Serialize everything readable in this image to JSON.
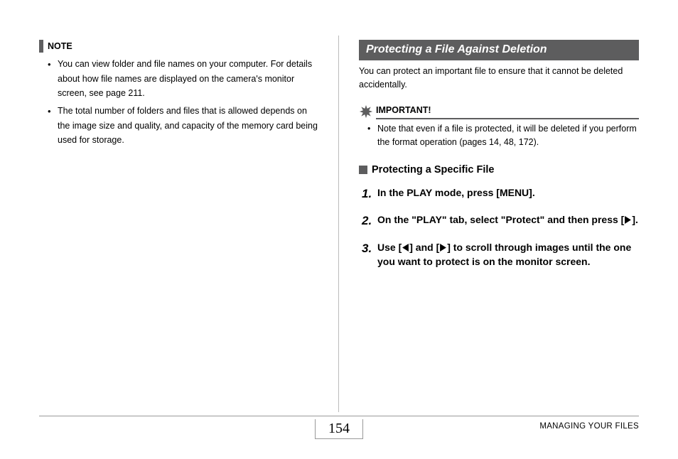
{
  "left": {
    "note_label": "NOTE",
    "bullets": [
      "You can view folder and file names on your computer. For details about how file names are displayed on the camera's monitor screen, see page 211.",
      "The total number of folders and files that is allowed depends on the image size and quality, and capacity of the memory card being used for storage."
    ]
  },
  "right": {
    "section_title": "Protecting a File Against Deletion",
    "intro": "You can protect an important file to ensure that it cannot be deleted accidentally.",
    "important_label": "IMPORTANT!",
    "important_bullets": [
      "Note that even if a file is protected, it will be deleted if you perform the format operation (pages 14, 48, 172)."
    ],
    "subheading": "Protecting a Specific File",
    "steps": {
      "s1": {
        "num": "1.",
        "text": "In the PLAY mode, press [MENU]."
      },
      "s2": {
        "num": "2.",
        "pre": "On the \"PLAY\" tab, select \"Protect\" and then press [",
        "post": "]."
      },
      "s3": {
        "num": "3.",
        "pre": "Use [",
        "mid": "] and [",
        "post": "] to scroll through images until the one you want to protect is on the monitor screen."
      }
    }
  },
  "footer": {
    "page_number": "154",
    "section": "MANAGING YOUR FILES"
  }
}
